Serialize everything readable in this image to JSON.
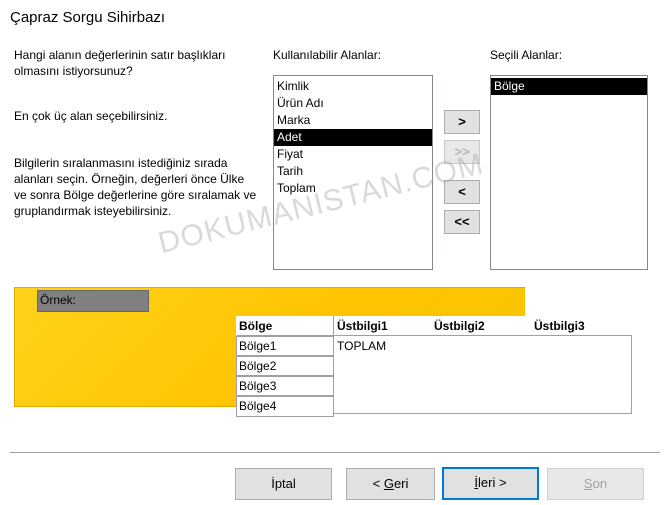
{
  "title": "Çapraz Sorgu Sihirbazı",
  "instructions": {
    "question": "Hangi alanın değerlerinin satır başlıkları olmasını istiyorsunuz?",
    "limit": "En çok üç alan seçebilirsiniz.",
    "order": "Bilgilerin sıralanmasını istediğiniz sırada alanları seçin. Örneğin, değerleri önce Ülke ve sonra Bölge değerlerine göre sıralamak ve gruplandırmak isteyebilirsiniz."
  },
  "available": {
    "label": "Kullanılabilir Alanlar:",
    "items": [
      "Kimlik",
      "Ürün Adı",
      "Marka",
      "Adet",
      "Fiyat",
      "Tarih",
      "Toplam"
    ],
    "selected": "Adet"
  },
  "chosen": {
    "label": "Seçili Alanlar:",
    "items": [
      "Bölge"
    ],
    "selected": "Bölge"
  },
  "move_buttons": {
    "add_one": ">",
    "add_all": ">>",
    "remove_one": "<",
    "remove_all": "<<"
  },
  "sample": {
    "label": "Örnek:",
    "row_header": "Bölge",
    "rows": [
      "Bölge1",
      "Bölge2",
      "Bölge3",
      "Bölge4"
    ],
    "col_headers": [
      "Üstbilgi1",
      "Üstbilgi2",
      "Üstbilgi3"
    ],
    "total": "TOPLAM"
  },
  "watermark": "DOKUMANISTAN.COM",
  "footer": {
    "cancel": "İptal",
    "back_pre": "< ",
    "back_u": "G",
    "back_post": "eri",
    "next_u": "İ",
    "next_post": "leri >",
    "finish_u": "S",
    "finish_post": "on"
  }
}
